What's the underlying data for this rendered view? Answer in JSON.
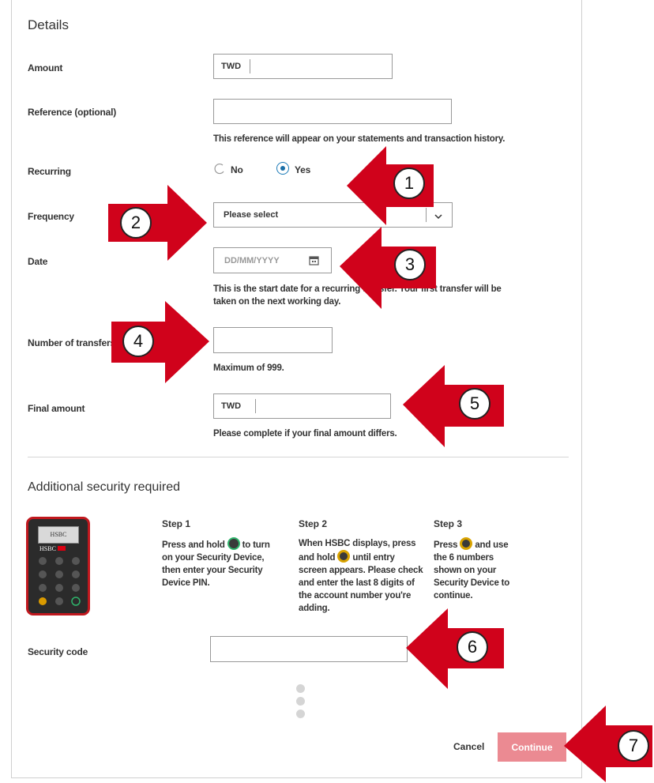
{
  "details": {
    "title": "Details",
    "amount": {
      "label": "Amount",
      "currency": "TWD"
    },
    "reference": {
      "label": "Reference (optional)",
      "help": "This reference will appear on your statements and transaction history."
    },
    "recurring": {
      "label": "Recurring",
      "options": [
        "No",
        "Yes"
      ],
      "selected": "Yes"
    },
    "frequency": {
      "label": "Frequency",
      "placeholder": "Please select"
    },
    "date": {
      "label": "Date",
      "placeholder": "DD/MM/YYYY",
      "help_line1": "This is the start date for a recurring transfer. Your first transfer will be",
      "help_line2": "taken on the next working day."
    },
    "transfers": {
      "label": "Number of transfers",
      "help": "Maximum of 999."
    },
    "final_amount": {
      "label": "Final amount",
      "currency": "TWD",
      "help": "Please complete if your final amount differs."
    }
  },
  "security": {
    "title": "Additional security required",
    "device": {
      "brand_top": "HSBC",
      "brand": "HSBC"
    },
    "steps": [
      {
        "title": "Step 1",
        "l1a": "Press and hold",
        "l1b": "to turn",
        "l2": "on your Security Device,",
        "l3": "then enter your Security",
        "l4": "Device PIN."
      },
      {
        "title": "Step 2",
        "l1": "When HSBC displays, press",
        "l2a": "and hold",
        "l2b": "until entry",
        "l3": "screen appears. Please check",
        "l4": "and enter the last 8 digits of",
        "l5": "the account number you're",
        "l6": "adding."
      },
      {
        "title": "Step 3",
        "l1a": "Press",
        "l1b": "and use",
        "l2": "the 6 numbers",
        "l3": "shown on your",
        "l4": "Security Device to",
        "l5": "continue."
      }
    ],
    "code_label": "Security code"
  },
  "actions": {
    "cancel": "Cancel",
    "continue": "Continue"
  },
  "callouts": [
    "1",
    "2",
    "3",
    "4",
    "5",
    "6",
    "7"
  ],
  "colors": {
    "arrow": "#d0021b",
    "continue_bg": "#eb8a92",
    "hsbc_red": "#db0011"
  }
}
